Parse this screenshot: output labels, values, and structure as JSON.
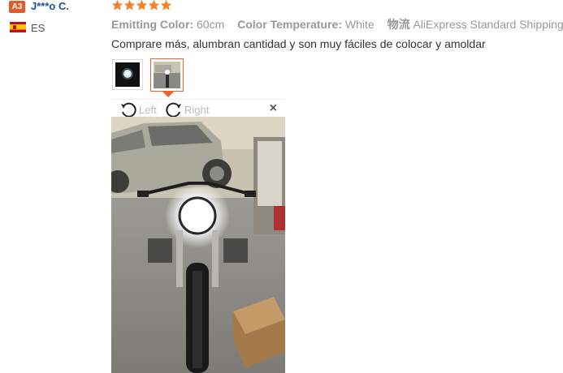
{
  "reviewer": {
    "level_badge": "A3",
    "name": "J***o C.",
    "country": "ES"
  },
  "rating": {
    "stars": 5,
    "star_color": "#f0842c"
  },
  "attributes": {
    "emitting_color_label": "Emitting Color:",
    "emitting_color_value": "60cm",
    "color_temp_label": "Color Temperature:",
    "color_temp_value": "White",
    "shipping_label": "物流",
    "shipping_value": "AliExpress Standard Shipping"
  },
  "review_text": "Comprare más, alumbran cantidad y son muy fáciles de colocar y amoldar",
  "thumbnails": [
    {
      "name": "headlight-thumbnail",
      "selected": false
    },
    {
      "name": "motorcycle-thumbnail",
      "selected": true
    }
  ],
  "viewer": {
    "rotate_left_label": "Left",
    "rotate_right_label": "Right",
    "close_label": "×"
  },
  "colors": {
    "accent": "#e8642c",
    "link": "#1c4fa8",
    "badge": "#e05c2b"
  }
}
